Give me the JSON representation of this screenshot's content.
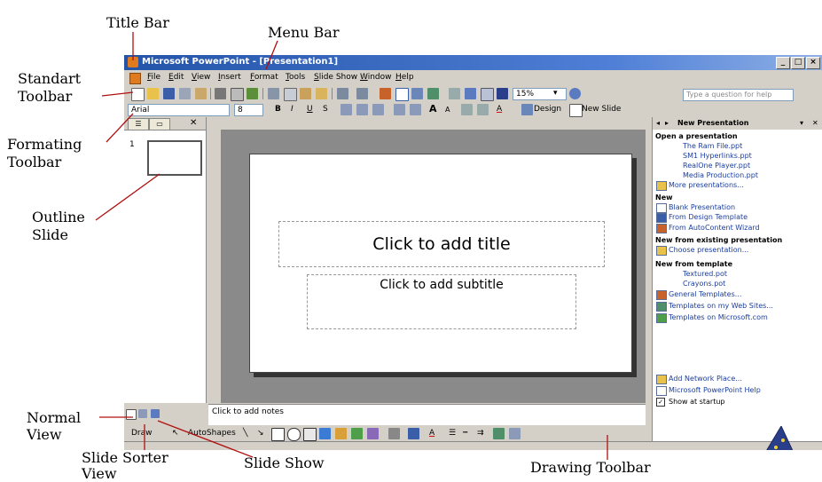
{
  "annotations": {
    "title_bar": "Title Bar",
    "menu_bar": "Menu Bar",
    "standart_toolbar_1": "Standart",
    "standart_toolbar_2": "Toolbar",
    "formatting_toolbar_1": "Formating",
    "formatting_toolbar_2": "Toolbar",
    "outline_slide_1": "Outline",
    "outline_slide_2": "Slide",
    "normal_view_1": "Normal",
    "normal_view_2": "View",
    "slide_sorter_view_1": "Slide Sorter",
    "slide_sorter_view_2": "View",
    "slide_show": "Slide Show",
    "drawing_toolbar": "Drawing Toolbar"
  },
  "window": {
    "title": "Microsoft PowerPoint - [Presentation1]",
    "controls": [
      "_",
      "□",
      "×"
    ]
  },
  "menu": {
    "items": [
      "File",
      "Edit",
      "View",
      "Insert",
      "Format",
      "Tools",
      "Slide Show",
      "Window",
      "Help"
    ],
    "help_placeholder": "Type a question for help"
  },
  "standard_toolbar": {
    "zoom": "15%"
  },
  "formatting_toolbar": {
    "font": "Arial",
    "size": "8",
    "design_label": "Design",
    "new_slide_label": "New Slide"
  },
  "slides_pane": {
    "slide_number": "1"
  },
  "slide": {
    "title_placeholder": "Click to add title",
    "subtitle_placeholder": "Click to add subtitle"
  },
  "notes": {
    "placeholder": "Click to add notes"
  },
  "drawing_toolbar": {
    "draw_label": "Draw",
    "autoshapes_label": "AutoShapes"
  },
  "task_pane": {
    "title": "New Presentation",
    "open_heading": "Open a presentation",
    "open_items": [
      "The Ram File.ppt",
      "SM1 Hyperlinks.ppt",
      "RealOne Player.ppt",
      "Media Production.ppt",
      "More presentations..."
    ],
    "new_heading": "New",
    "new_items": [
      "Blank Presentation",
      "From Design Template",
      "From AutoContent Wizard"
    ],
    "existing_heading": "New from existing presentation",
    "existing_items": [
      "Choose presentation..."
    ],
    "template_heading": "New from template",
    "template_items": [
      "Textured.pot",
      "Crayons.pot",
      "General Templates...",
      "Templates on my Web Sites...",
      "Templates on Microsoft.com"
    ],
    "bottom_items": [
      "Add Network Place...",
      "Microsoft PowerPoint Help"
    ],
    "startup_label": "Show at startup"
  }
}
